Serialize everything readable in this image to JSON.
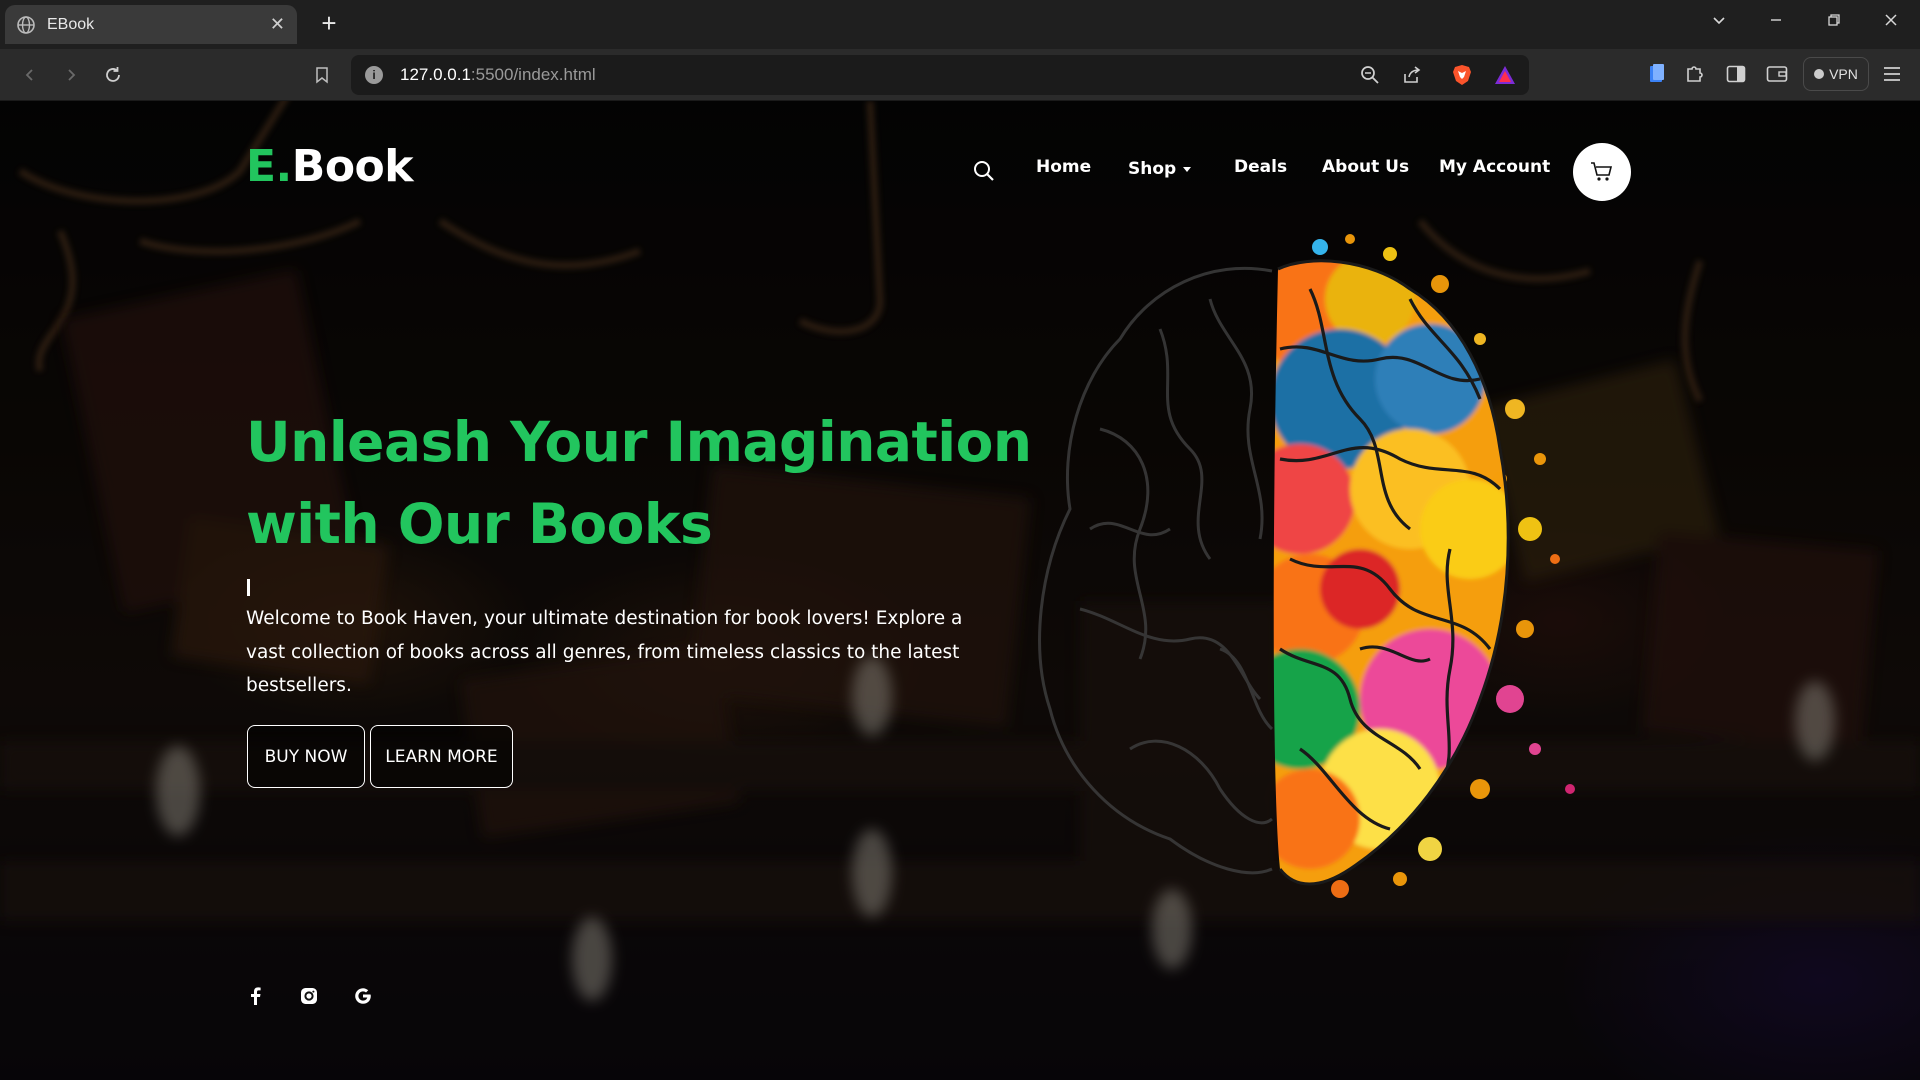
{
  "browser": {
    "tab_title": "EBook",
    "tab_close": "✕",
    "new_tab": "+",
    "url_host": "127.0.0.1",
    "url_rest": ":5500/index.html",
    "vpn_label": "VPN"
  },
  "site": {
    "logo_accent": "E.",
    "logo_main": "Book",
    "nav": {
      "home": "Home",
      "shop": "Shop",
      "deals": "Deals",
      "about": "About Us",
      "account": "My Account"
    },
    "hero": {
      "title_line1": "Unleash Your Imagination",
      "title_line2": "with Our Books",
      "description": "Welcome to Book Haven, your ultimate destination for book lovers! Explore a vast collection of books across all genres, from timeless classics to the latest bestsellers.",
      "buy_label": "BUY NOW",
      "learn_label": "LEARN MORE"
    },
    "social": [
      "facebook-icon",
      "instagram-icon",
      "google-icon"
    ]
  },
  "colors": {
    "accent": "#22c55e",
    "page_bg": "#0a0806",
    "text": "#ffffff"
  }
}
